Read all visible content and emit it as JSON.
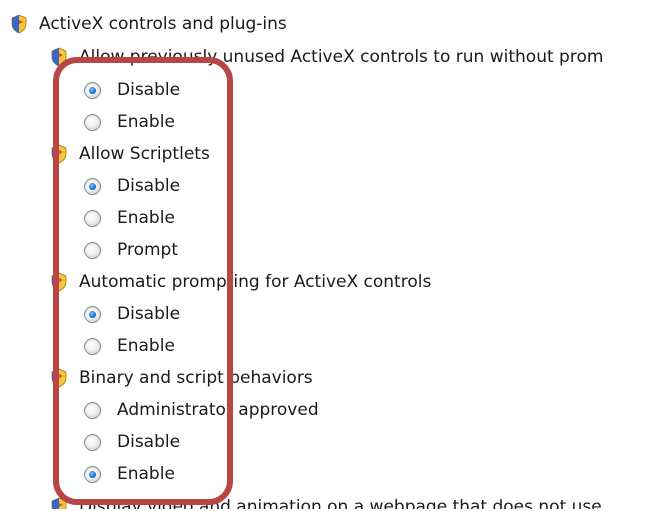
{
  "category": {
    "label": "ActiveX controls and plug-ins",
    "icon": "settings-shield-icon"
  },
  "settings": [
    {
      "label": "Allow previously unused ActiveX controls to run without prom",
      "options": [
        {
          "label": "Disable",
          "checked": true
        },
        {
          "label": "Enable",
          "checked": false
        }
      ]
    },
    {
      "label": "Allow Scriptlets",
      "options": [
        {
          "label": "Disable",
          "checked": true
        },
        {
          "label": "Enable",
          "checked": false
        },
        {
          "label": "Prompt",
          "checked": false
        }
      ]
    },
    {
      "label": "Automatic prompting for ActiveX controls",
      "options": [
        {
          "label": "Disable",
          "checked": true
        },
        {
          "label": "Enable",
          "checked": false
        }
      ]
    },
    {
      "label": "Binary and script behaviors",
      "options": [
        {
          "label": "Administrator approved",
          "checked": false
        },
        {
          "label": "Disable",
          "checked": false
        },
        {
          "label": "Enable",
          "checked": true
        }
      ]
    },
    {
      "label": "Display video and animation on a webpage that does not use",
      "options": []
    }
  ],
  "colors": {
    "highlight_border": "#b84646",
    "radio_checked": "#1a6fd0"
  }
}
